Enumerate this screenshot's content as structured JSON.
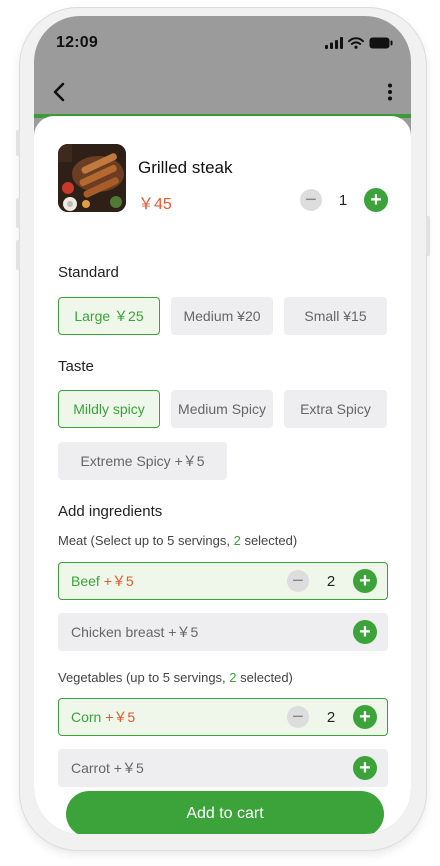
{
  "status_bar": {
    "time": "12:09"
  },
  "nav": {
    "back_icon": "back-arrow-icon",
    "more_icon": "more-vertical-icon"
  },
  "product": {
    "name": "Grilled steak",
    "price": "￥45",
    "quantity": "1"
  },
  "standard": {
    "title": "Standard",
    "options": [
      {
        "label": "Large  ￥25",
        "selected": true
      },
      {
        "label": "Medium ¥20",
        "selected": false
      },
      {
        "label": "Small ¥15",
        "selected": false
      }
    ]
  },
  "taste": {
    "title": "Taste",
    "options": [
      {
        "label": "Mildly spicy",
        "selected": true
      },
      {
        "label": "Medium Spicy",
        "selected": false
      },
      {
        "label": "Extra Spicy",
        "selected": false
      },
      {
        "label": "Extreme Spicy +￥5",
        "selected": false
      }
    ]
  },
  "ingredients": {
    "title": "Add ingredients",
    "meat": {
      "subtitle_prefix": "Meat (Select up to 5 servings, ",
      "subtitle_count": "2",
      "subtitle_suffix": " selected)",
      "items": [
        {
          "name": "Beef",
          "extra": "+￥5",
          "quantity": "2",
          "selected": true
        },
        {
          "name": "Chicken breast +￥5",
          "selected": false
        }
      ]
    },
    "vegetables": {
      "subtitle_prefix": "Vegetables (up to 5 servings, ",
      "subtitle_count": "2",
      "subtitle_suffix": " selected)",
      "items": [
        {
          "name": "Corn",
          "extra": "+￥5",
          "quantity": "2",
          "selected": true
        },
        {
          "name": "Carrot +￥5",
          "selected": false
        }
      ]
    }
  },
  "cart": {
    "label": "Add to cart"
  },
  "colors": {
    "accent": "#3ba33a",
    "price": "#e8582f",
    "chip_bg": "#eeeef0"
  }
}
